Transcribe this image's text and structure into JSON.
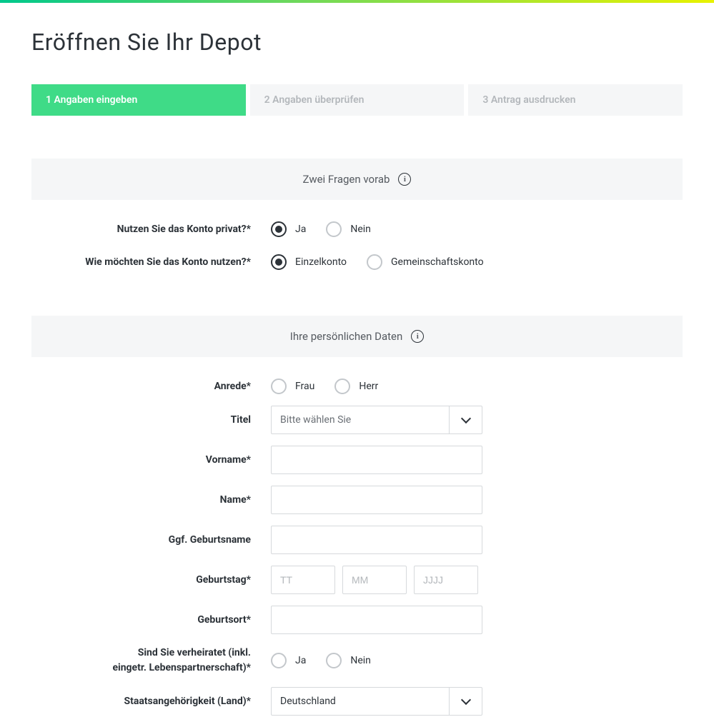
{
  "page": {
    "title": "Eröffnen Sie Ihr Depot"
  },
  "progress": {
    "step1": "1 Angaben eingeben",
    "step2": "2 Angaben überprüfen",
    "step3": "3 Antrag ausdrucken"
  },
  "section1": {
    "title": "Zwei Fragen vorab",
    "q1_label": "Nutzen Sie das Konto privat?*",
    "q1_yes": "Ja",
    "q1_no": "Nein",
    "q2_label": "Wie möchten Sie das Konto nutzen?*",
    "q2_single": "Einzelkonto",
    "q2_joint": "Gemeinschaftskonto"
  },
  "section2": {
    "title": "Ihre persönlichen Daten",
    "salutation_label": "Anrede*",
    "salutation_frau": "Frau",
    "salutation_herr": "Herr",
    "title_label": "Titel",
    "title_placeholder": "Bitte wählen Sie",
    "firstname_label": "Vorname*",
    "lastname_label": "Name*",
    "birthname_label": "Ggf. Geburtsname",
    "birthday_label": "Geburtstag*",
    "birthday_dd": "TT",
    "birthday_mm": "MM",
    "birthday_yyyy": "JJJJ",
    "birthplace_label": "Geburtsort*",
    "married_label_line1": "Sind Sie verheiratet (inkl.",
    "married_label_line2": "eingetr. Lebenspartnerschaft)*",
    "married_yes": "Ja",
    "married_no": "Nein",
    "nationality_label": "Staatsangehörigkeit (Land)*",
    "nationality_value": "Deutschland"
  }
}
